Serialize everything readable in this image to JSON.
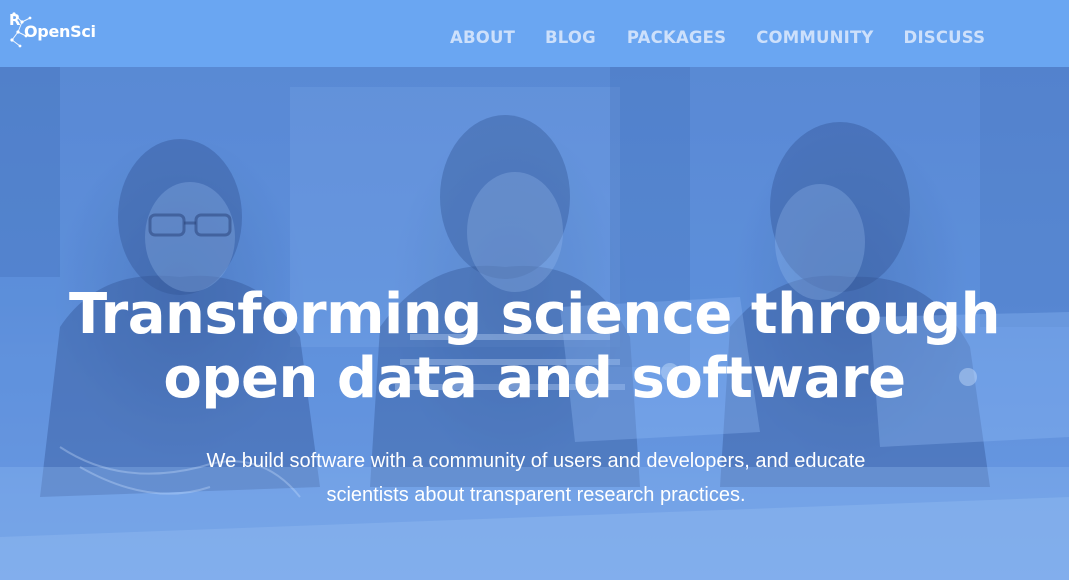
{
  "brand": {
    "logo_r": "R",
    "logo_text": "OpenSci"
  },
  "nav": {
    "items": [
      {
        "label": "ABOUT"
      },
      {
        "label": "BLOG"
      },
      {
        "label": "PACKAGES"
      },
      {
        "label": "COMMUNITY"
      },
      {
        "label": "DISCUSS"
      }
    ]
  },
  "hero": {
    "title_line1": "Transforming science through",
    "title_line2": "open data and software",
    "subtitle": "We build software with a community of users and developers, and educate scientists about transparent research practices."
  },
  "colors": {
    "navbar": "#6aa6f2",
    "hero_tint": "#5b8fdb",
    "nav_text": "#cde0fb",
    "hero_text": "#ffffff"
  }
}
